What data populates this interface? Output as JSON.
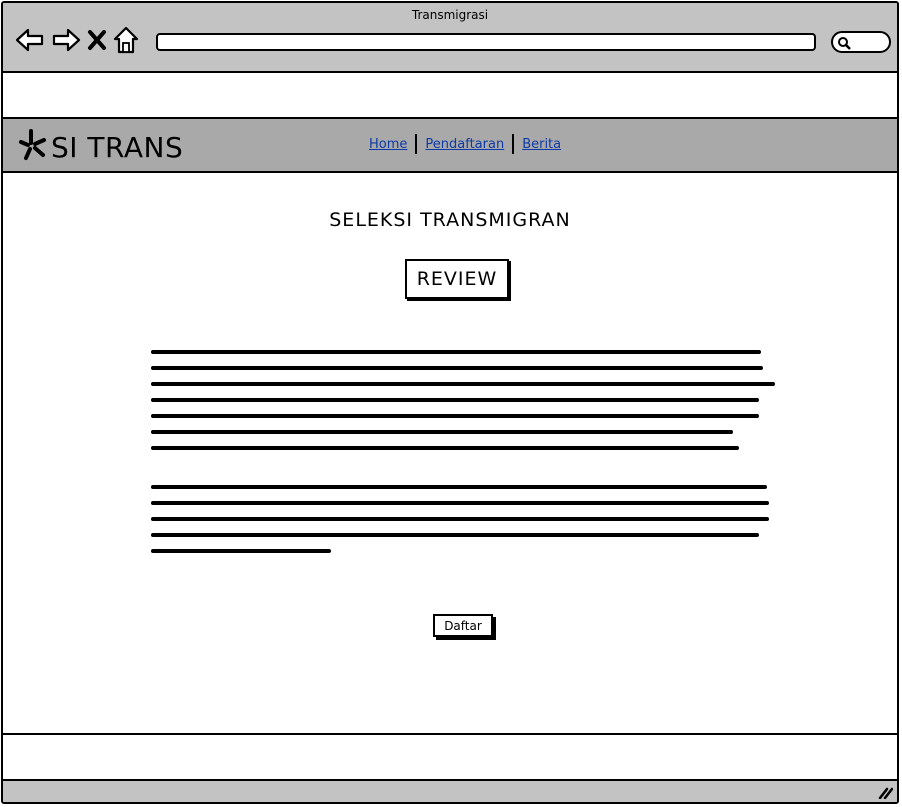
{
  "window": {
    "title": "Transmigrasi"
  },
  "toolbar": {
    "back_icon": "back-arrow-icon",
    "forward_icon": "forward-arrow-icon",
    "close_icon": "close-x-icon",
    "home_icon": "home-icon",
    "address_value": "",
    "search_icon": "search-icon"
  },
  "header": {
    "brand": "SI TRANS",
    "logo_icon": "star-burst-icon",
    "nav": [
      "Home",
      "Pendaftaran",
      "Berita"
    ]
  },
  "main": {
    "title": "SELEKSI TRANSMIGRAN",
    "section_label": "REVIEW",
    "button_label": "Daftar"
  },
  "colors": {
    "chrome": "#c3c3c3",
    "header": "#a9a9a9",
    "link": "#0d3aa8"
  }
}
